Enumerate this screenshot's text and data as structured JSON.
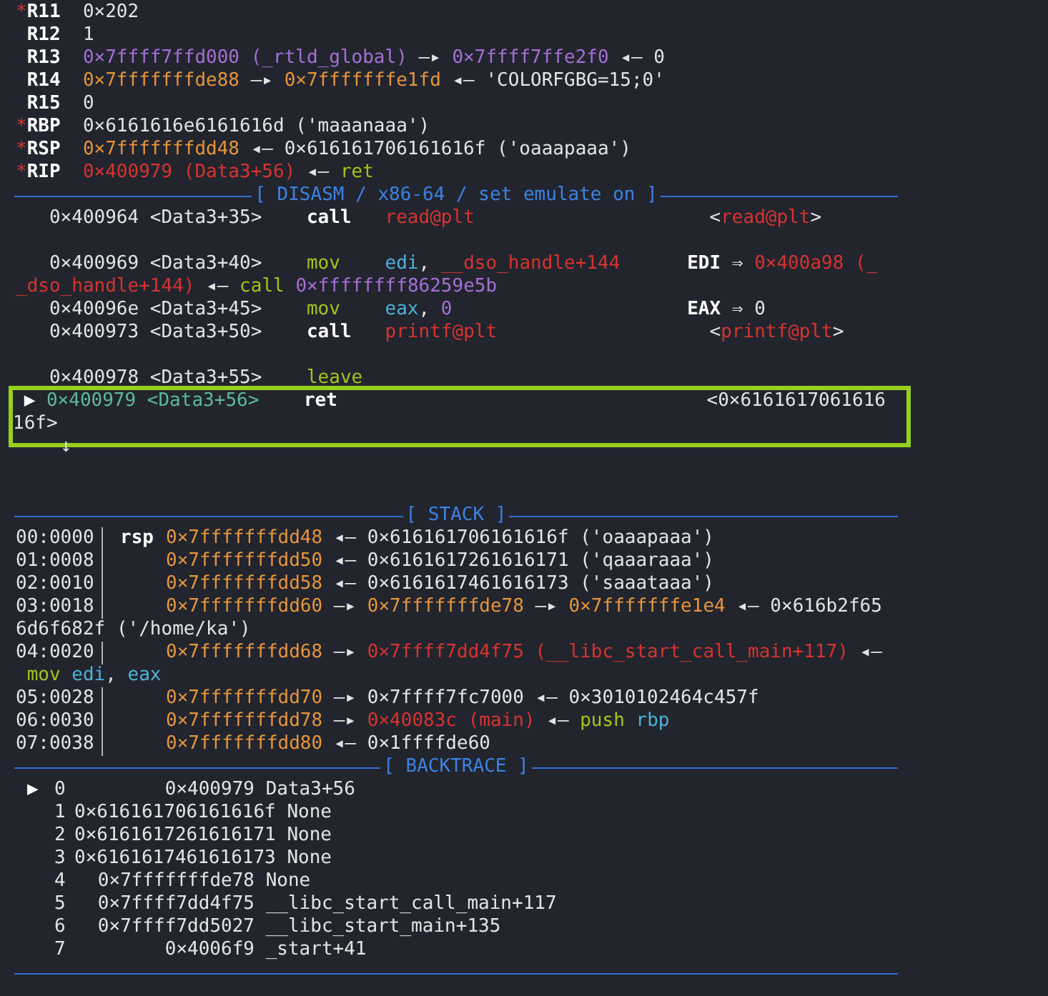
{
  "registers": {
    "changed_marker": "*",
    "items": [
      {
        "name": "R11",
        "changed": true,
        "value": [
          {
            "text": "0×202",
            "kind": "plain"
          }
        ]
      },
      {
        "name": "R12",
        "changed": false,
        "value": [
          {
            "text": "1",
            "kind": "plain"
          }
        ]
      },
      {
        "name": "R13",
        "changed": false,
        "value": [
          {
            "text": "0×7ffff7ffd000 (_rtld_global)",
            "kind": "data"
          },
          {
            "text": " —▸ ",
            "kind": "plain"
          },
          {
            "text": "0×7ffff7ffe2f0",
            "kind": "data"
          },
          {
            "text": " ◂— 0",
            "kind": "plain"
          }
        ]
      },
      {
        "name": "R14",
        "changed": false,
        "value": [
          {
            "text": "0×7fffffffde88",
            "kind": "stack"
          },
          {
            "text": " —▸ ",
            "kind": "plain"
          },
          {
            "text": "0×7fffffffe1fd",
            "kind": "stack"
          },
          {
            "text": " ◂— 'COLORFGBG=15;0'",
            "kind": "plain"
          }
        ]
      },
      {
        "name": "R15",
        "changed": false,
        "value": [
          {
            "text": "0",
            "kind": "plain"
          }
        ]
      },
      {
        "name": "RBP",
        "changed": true,
        "value": [
          {
            "text": "0×6161616e6161616d ('maaanaaa')",
            "kind": "plain"
          }
        ]
      },
      {
        "name": "RSP",
        "changed": true,
        "value": [
          {
            "text": "0×7fffffffdd48",
            "kind": "stack"
          },
          {
            "text": " ◂— 0×616161706161616f ('oaaapaaa')",
            "kind": "plain"
          }
        ]
      },
      {
        "name": "RIP",
        "changed": true,
        "value": [
          {
            "text": "0×400979 (Data3+56)",
            "kind": "code"
          },
          {
            "text": " ◂— ",
            "kind": "plain"
          },
          {
            "text": "ret",
            "kind": "mnem"
          }
        ]
      }
    ]
  },
  "disasm": {
    "title": "[ DISASM / x86-64 / set emulate on ]",
    "marker": "▶",
    "lines": [
      {
        "kind": "text",
        "current": false,
        "boxed": false,
        "segments": [
          {
            "text": "0×400964 <Data3+35>    ",
            "kind": "plain"
          },
          {
            "text": "call   ",
            "kind": "bold"
          },
          {
            "text": "read@plt",
            "kind": "code"
          },
          {
            "text": "                     <",
            "kind": "plain"
          },
          {
            "text": "read@plt",
            "kind": "code"
          },
          {
            "text": ">",
            "kind": "plain"
          }
        ]
      },
      {
        "kind": "blank",
        "current": false,
        "boxed": false
      },
      {
        "kind": "text",
        "current": false,
        "boxed": false,
        "segments": [
          {
            "text": "0×400969 <Data3+40>    ",
            "kind": "plain"
          },
          {
            "text": "mov    ",
            "kind": "mnem"
          },
          {
            "text": "edi",
            "kind": "reg"
          },
          {
            "text": ", ",
            "kind": "plain"
          },
          {
            "text": "__dso_handle+144      ",
            "kind": "code"
          },
          {
            "text": "EDI",
            "kind": "bold"
          },
          {
            "text": " ⇒ ",
            "kind": "plain"
          },
          {
            "text": "0×400a98 (_",
            "kind": "code"
          }
        ]
      },
      {
        "kind": "wrap",
        "current": false,
        "boxed": false,
        "segments": [
          {
            "text": "_dso_handle+144)",
            "kind": "code"
          },
          {
            "text": " ◂— ",
            "kind": "plain"
          },
          {
            "text": "call ",
            "kind": "mnem"
          },
          {
            "text": "0×ffffffff86259e5b",
            "kind": "data"
          }
        ]
      },
      {
        "kind": "text",
        "current": false,
        "boxed": false,
        "segments": [
          {
            "text": "0×40096e <Data3+45>    ",
            "kind": "plain"
          },
          {
            "text": "mov    ",
            "kind": "mnem"
          },
          {
            "text": "eax",
            "kind": "reg"
          },
          {
            "text": ", ",
            "kind": "plain"
          },
          {
            "text": "0                     ",
            "kind": "data"
          },
          {
            "text": "EAX",
            "kind": "bold"
          },
          {
            "text": " ⇒ 0",
            "kind": "plain"
          }
        ]
      },
      {
        "kind": "text",
        "current": false,
        "boxed": false,
        "segments": [
          {
            "text": "0×400973 <Data3+50>    ",
            "kind": "plain"
          },
          {
            "text": "call   ",
            "kind": "bold"
          },
          {
            "text": "printf@plt",
            "kind": "code"
          },
          {
            "text": "                   <",
            "kind": "plain"
          },
          {
            "text": "printf@plt",
            "kind": "code"
          },
          {
            "text": ">",
            "kind": "plain"
          }
        ]
      },
      {
        "kind": "blank",
        "current": false,
        "boxed": false
      },
      {
        "kind": "text",
        "current": false,
        "boxed": false,
        "segments": [
          {
            "text": "0×400978 <Data3+55>    ",
            "kind": "plain"
          },
          {
            "text": "leave",
            "kind": "mnem"
          }
        ]
      },
      {
        "kind": "text",
        "current": true,
        "boxed": true,
        "segments": [
          {
            "text": "0×400979 <Data3+56>    ",
            "kind": "current"
          },
          {
            "text": "ret",
            "kind": "bold"
          },
          {
            "text": "                                 <0×6161617061616",
            "kind": "plain"
          }
        ]
      },
      {
        "kind": "wrap",
        "current": false,
        "boxed": true,
        "segments": [
          {
            "text": "16f>",
            "kind": "plain"
          }
        ]
      },
      {
        "kind": "text",
        "current": false,
        "boxed": false,
        "segments": [
          {
            "text": " ↓",
            "kind": "plain"
          }
        ]
      },
      {
        "kind": "blank",
        "current": false,
        "boxed": false
      },
      {
        "kind": "blank",
        "current": false,
        "boxed": false
      }
    ]
  },
  "stack": {
    "title": "[ STACK ]",
    "rows": [
      {
        "index": "00:0000",
        "label": "rsp",
        "segments": [
          {
            "text": "0×7fffffffdd48",
            "kind": "stack"
          },
          {
            "text": " ◂— 0×616161706161616f ('oaaapaaa')",
            "kind": "plain"
          }
        ]
      },
      {
        "index": "01:0008",
        "segments": [
          {
            "text": "0×7fffffffdd50",
            "kind": "stack"
          },
          {
            "text": " ◂— 0×6161617261616171 ('qaaaraaa')",
            "kind": "plain"
          }
        ]
      },
      {
        "index": "02:0010",
        "segments": [
          {
            "text": "0×7fffffffdd58",
            "kind": "stack"
          },
          {
            "text": " ◂— 0×6161617461616173 ('saaataaa')",
            "kind": "plain"
          }
        ]
      },
      {
        "index": "03:0018",
        "segments": [
          {
            "text": "0×7fffffffdd60",
            "kind": "stack"
          },
          {
            "text": " —▸ ",
            "kind": "plain"
          },
          {
            "text": "0×7fffffffde78",
            "kind": "stack"
          },
          {
            "text": " —▸ ",
            "kind": "plain"
          },
          {
            "text": "0×7fffffffe1e4",
            "kind": "stack"
          },
          {
            "text": " ◂— 0×616b2f65",
            "kind": "plain"
          }
        ]
      },
      {
        "segments": [
          {
            "text": "6d6f682f ('/home/ka')",
            "kind": "plain"
          }
        ]
      },
      {
        "index": "04:0020",
        "segments": [
          {
            "text": "0×7fffffffdd68",
            "kind": "stack"
          },
          {
            "text": " —▸ ",
            "kind": "plain"
          },
          {
            "text": "0×7ffff7dd4f75 (__libc_start_call_main+117)",
            "kind": "code"
          },
          {
            "text": " ◂—",
            "kind": "plain"
          }
        ]
      },
      {
        "segments": [
          {
            "text": " mov ",
            "kind": "mnem"
          },
          {
            "text": "edi",
            "kind": "reg"
          },
          {
            "text": ", ",
            "kind": "plain"
          },
          {
            "text": "eax",
            "kind": "reg"
          }
        ]
      },
      {
        "index": "05:0028",
        "segments": [
          {
            "text": "0×7fffffffdd70",
            "kind": "stack"
          },
          {
            "text": " —▸ 0×7ffff7fc7000 ◂— 0×3010102464c457f",
            "kind": "plain"
          }
        ]
      },
      {
        "index": "06:0030",
        "segments": [
          {
            "text": "0×7fffffffdd78",
            "kind": "stack"
          },
          {
            "text": " —▸ ",
            "kind": "plain"
          },
          {
            "text": "0×40083c (main)",
            "kind": "code"
          },
          {
            "text": " ◂— ",
            "kind": "plain"
          },
          {
            "text": "push ",
            "kind": "mnem"
          },
          {
            "text": "rbp",
            "kind": "reg"
          }
        ]
      },
      {
        "index": "07:0038",
        "segments": [
          {
            "text": "0×7fffffffdd80",
            "kind": "stack"
          },
          {
            "text": " ◂— 0×1ffffde60",
            "kind": "plain"
          }
        ]
      }
    ]
  },
  "backtrace": {
    "title": "[ BACKTRACE ]",
    "marker": "▶",
    "frames": [
      {
        "selected": true,
        "number": "0",
        "address": "0×400979",
        "symbol": "Data3+56"
      },
      {
        "selected": false,
        "number": "1",
        "address": "0×616161706161616f",
        "symbol": "None"
      },
      {
        "selected": false,
        "number": "2",
        "address": "0×6161617261616171",
        "symbol": "None"
      },
      {
        "selected": false,
        "number": "3",
        "address": "0×6161617461616173",
        "symbol": "None"
      },
      {
        "selected": false,
        "number": "4",
        "address": "0×7fffffffde78",
        "symbol": "None"
      },
      {
        "selected": false,
        "number": "5",
        "address": "0×7ffff7dd4f75",
        "symbol": "__libc_start_call_main+117"
      },
      {
        "selected": false,
        "number": "6",
        "address": "0×7ffff7dd5027",
        "symbol": "__libc_start_main+135"
      },
      {
        "selected": false,
        "number": "7",
        "address": "0×4006f9",
        "symbol": "_start+41"
      }
    ]
  }
}
